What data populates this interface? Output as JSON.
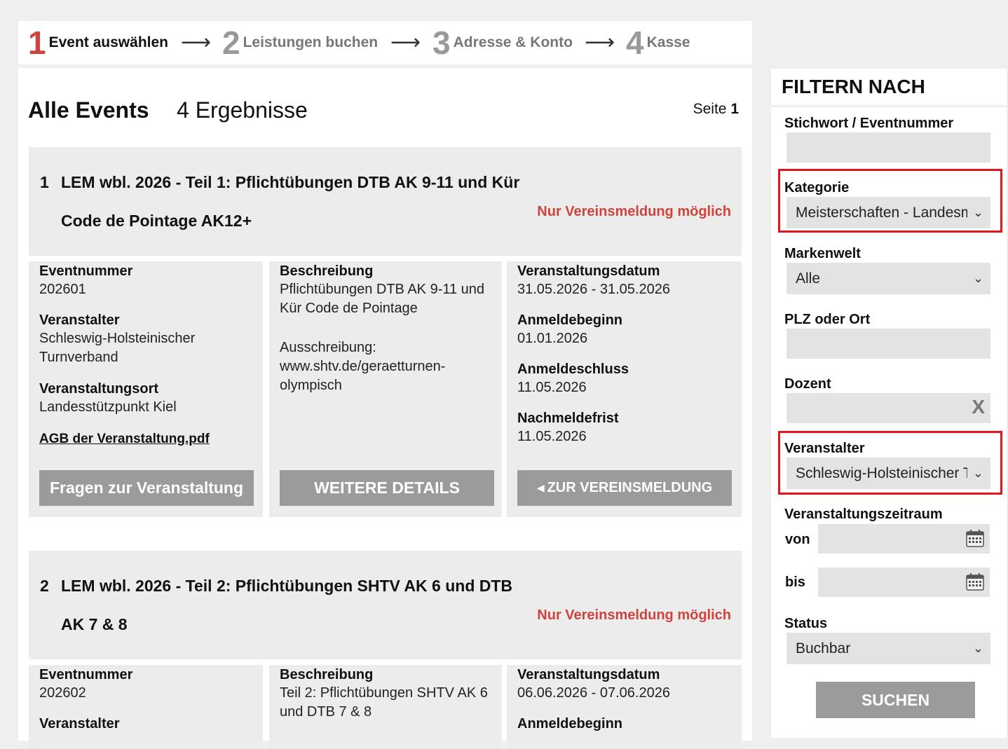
{
  "steps": [
    {
      "num": "1",
      "label": "Event auswählen",
      "active": true
    },
    {
      "num": "2",
      "label": "Leistungen buchen",
      "active": false
    },
    {
      "num": "3",
      "label": "Adresse & Konto",
      "active": false
    },
    {
      "num": "4",
      "label": "Kasse",
      "active": false
    }
  ],
  "arrow": "⟶",
  "results": {
    "title": "Alle Events",
    "count": "4 Ergebnisse",
    "page_label": "Seite",
    "page_num": "1"
  },
  "events": [
    {
      "num": "1",
      "title": "LEM wbl. 2026 - Teil 1: Pflichtübungen DTB AK 9-11 und Kür Code de Pointage AK12+",
      "note": "Nur Vereinsmeldung möglich",
      "eventnummer_label": "Eventnummer",
      "eventnummer": "202601",
      "veranstalter_label": "Veranstalter",
      "veranstalter": "Schleswig-Holsteinischer Turnverband",
      "ort_label": "Veranstaltungsort",
      "ort": "Landesstützpunkt Kiel",
      "agb": "AGB der Veranstaltung.pdf",
      "beschreibung_label": "Beschreibung",
      "beschreibung": "Pflichtübungen DTB AK 9-11 und Kür Code de Pointage",
      "ausschreibung": "Ausschreibung: www.shtv.de/geraetturnen-olympisch",
      "datum_label": "Veranstaltungsdatum",
      "datum": "31.05.2026 - 31.05.2026",
      "anmeldebeginn_label": "Anmeldebeginn",
      "anmeldebeginn": "01.01.2026",
      "anmeldeschluss_label": "Anmeldeschluss",
      "anmeldeschluss": "11.05.2026",
      "nachmeldefrist_label": "Nachmeldefrist",
      "nachmeldefrist": "11.05.2026",
      "btn_fragen": "Fragen zur Veranstaltung",
      "btn_details": "WEITERE DETAILS",
      "btn_verein": "ZUR VEREINSMELDUNG"
    },
    {
      "num": "2",
      "title": "LEM wbl. 2026 - Teil 2: Pflichtübungen SHTV AK 6 und DTB AK 7 & 8",
      "note": "Nur Vereinsmeldung möglich",
      "eventnummer_label": "Eventnummer",
      "eventnummer": "202602",
      "veranstalter_label": "Veranstalter",
      "beschreibung_label": "Beschreibung",
      "beschreibung": "Teil 2: Pflichtübungen SHTV AK 6 und DTB 7 & 8",
      "datum_label": "Veranstaltungsdatum",
      "datum": "06.06.2026 - 07.06.2026",
      "anmeldebeginn_label": "Anmeldebeginn"
    }
  ],
  "filter": {
    "title": "FILTERN NACH",
    "stichwort_label": "Stichwort / Eventnummer",
    "stichwort_value": "",
    "kategorie_label": "Kategorie",
    "kategorie_value": "Meisterschaften - Landesmeisterschaften",
    "markenwelt_label": "Markenwelt",
    "markenwelt_value": "Alle",
    "plz_label": "PLZ oder Ort",
    "plz_value": "",
    "dozent_label": "Dozent",
    "dozent_value": "",
    "dozent_clear": "X",
    "veranstalter_label": "Veranstalter",
    "veranstalter_value": "Schleswig-Holsteinischer Turnverband",
    "zeitraum_label": "Veranstaltungszeitraum",
    "von_label": "von",
    "bis_label": "bis",
    "status_label": "Status",
    "status_value": "Buchbar",
    "search_button": "SUCHEN"
  }
}
